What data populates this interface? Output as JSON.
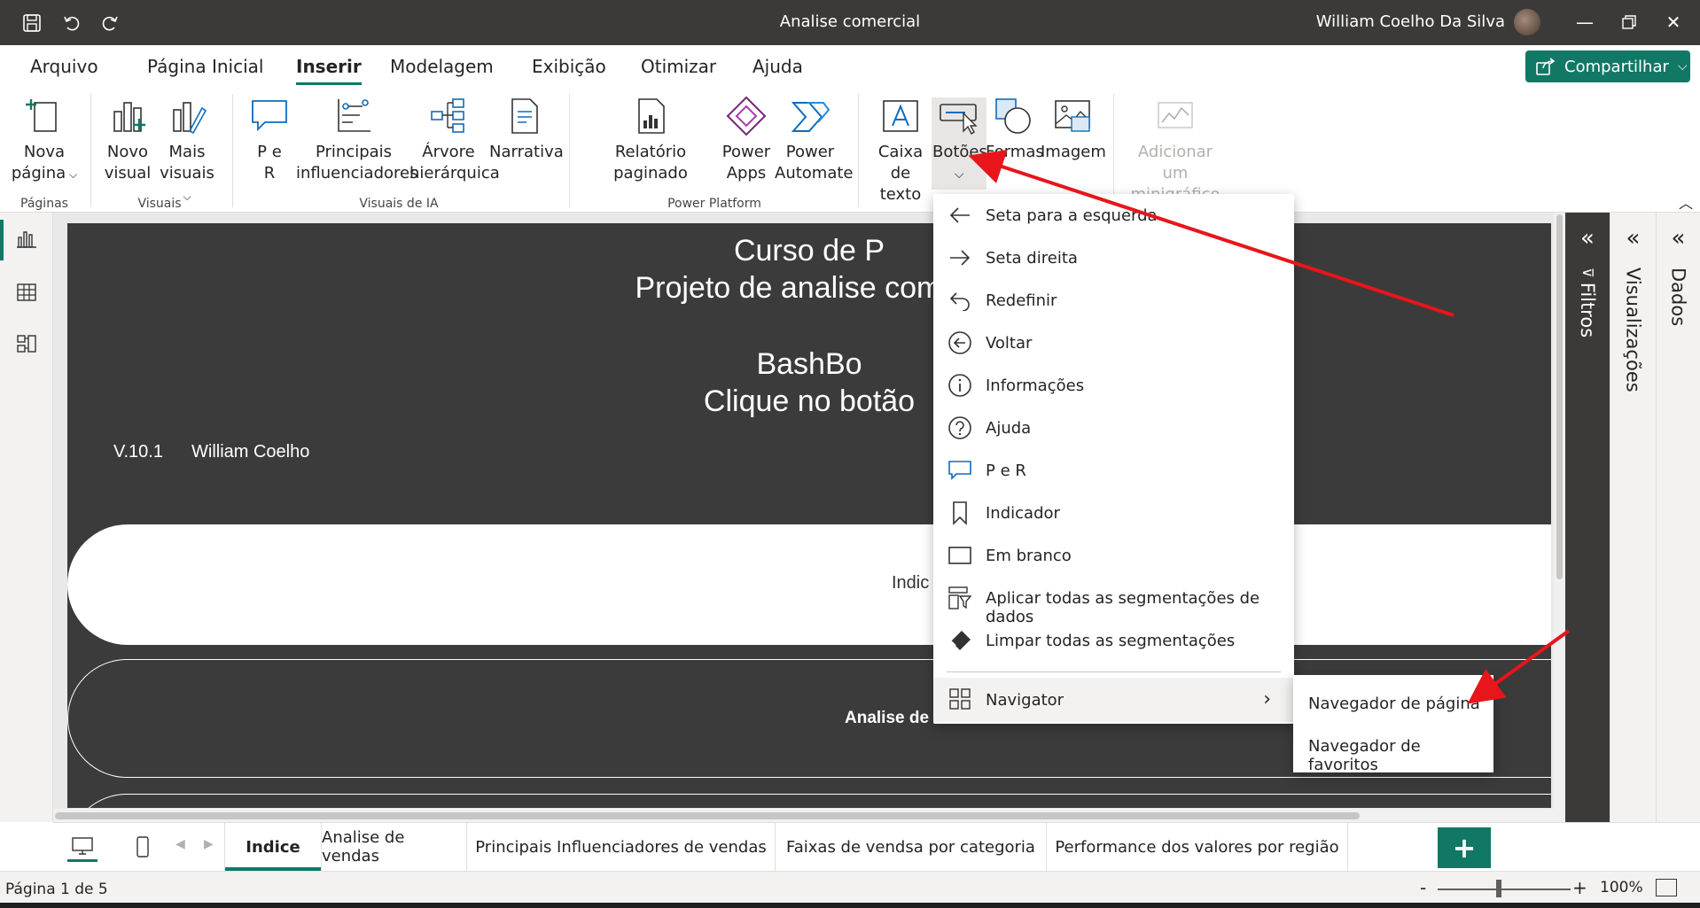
{
  "window": {
    "title": "Analise comercial",
    "user_name": "William Coelho Da Silva"
  },
  "menu": {
    "tabs": [
      "Arquivo",
      "Página Inicial",
      "Inserir",
      "Modelagem",
      "Exibição",
      "Otimizar",
      "Ajuda"
    ],
    "active_tab": "Inserir",
    "share_label": "Compartilhar"
  },
  "ribbon": {
    "buttons": {
      "nova_pagina": [
        "Nova",
        "página"
      ],
      "novo_visual": [
        "Novo",
        "visual"
      ],
      "mais_visuais": [
        "Mais",
        "visuais"
      ],
      "pe_r": [
        "P e",
        "R"
      ],
      "principais": [
        "Principais",
        "influenciadores"
      ],
      "arvore": [
        "Árvore",
        "hierárquica"
      ],
      "narrativa": "Narrativa",
      "relatorio": "Relatório paginado",
      "power_apps": [
        "Power",
        "Apps"
      ],
      "power_automate": [
        "Power",
        "Automate"
      ],
      "caixa_texto": [
        "Caixa de",
        "texto"
      ],
      "botoes": "Botões",
      "formas": "Formas",
      "imagem": "Imagem",
      "minigrafico": [
        "Adicionar um",
        "minigráfico"
      ]
    },
    "groups": {
      "paginas": "Páginas",
      "visuais": "Visuais",
      "visuais_ia": "Visuais de IA",
      "power_platform": "Power Platform"
    }
  },
  "report_page": {
    "title_line1": "Curso de P",
    "title_line2": "Projeto de analise comerc",
    "title_line3": "BashBo",
    "title_line4": "Clique no botão",
    "version": "V.10.1",
    "author": "William Coelho",
    "pill1_text": "Indic",
    "pill2_text": "Analise de"
  },
  "dropdown": {
    "items": [
      {
        "label": "Seta para a esquerda",
        "icon": "arrow-left-icon"
      },
      {
        "label": "Seta direita",
        "icon": "arrow-right-icon"
      },
      {
        "label": "Redefinir",
        "icon": "undo-icon"
      },
      {
        "label": "Voltar",
        "icon": "back-circle-icon"
      },
      {
        "label": "Informações",
        "icon": "info-icon"
      },
      {
        "label": "Ajuda",
        "icon": "help-icon"
      },
      {
        "label": "P e R",
        "icon": "qa-icon"
      },
      {
        "label": "Indicador",
        "icon": "bookmark-icon"
      },
      {
        "label": "Em branco",
        "icon": "blank-icon"
      },
      {
        "label": "Aplicar todas as segmentações de dados",
        "icon": "apply-slicers-icon"
      },
      {
        "label": "Limpar todas as segmentações",
        "icon": "eraser-icon"
      }
    ],
    "navigator_label": "Navigator",
    "submenu": [
      "Navegador de página",
      "Navegador de favoritos"
    ]
  },
  "panes": {
    "filtros": "Filtros",
    "visualizacoes": "Visualizações",
    "dados": "Dados"
  },
  "page_tabs": [
    "Indice",
    "Analise de vendas",
    "Principais Influenciadores de vendas",
    "Faixas de vendsa por categoria",
    "Performance dos valores por região"
  ],
  "active_page_tab": "Indice",
  "status": {
    "page_info": "Página 1 de 5",
    "zoom": "100%"
  },
  "colors": {
    "accent": "#117865",
    "titlebar": "#3b3a39",
    "canvas_bg": "#3b3b3b",
    "annotation_arrow": "#e8151b"
  }
}
